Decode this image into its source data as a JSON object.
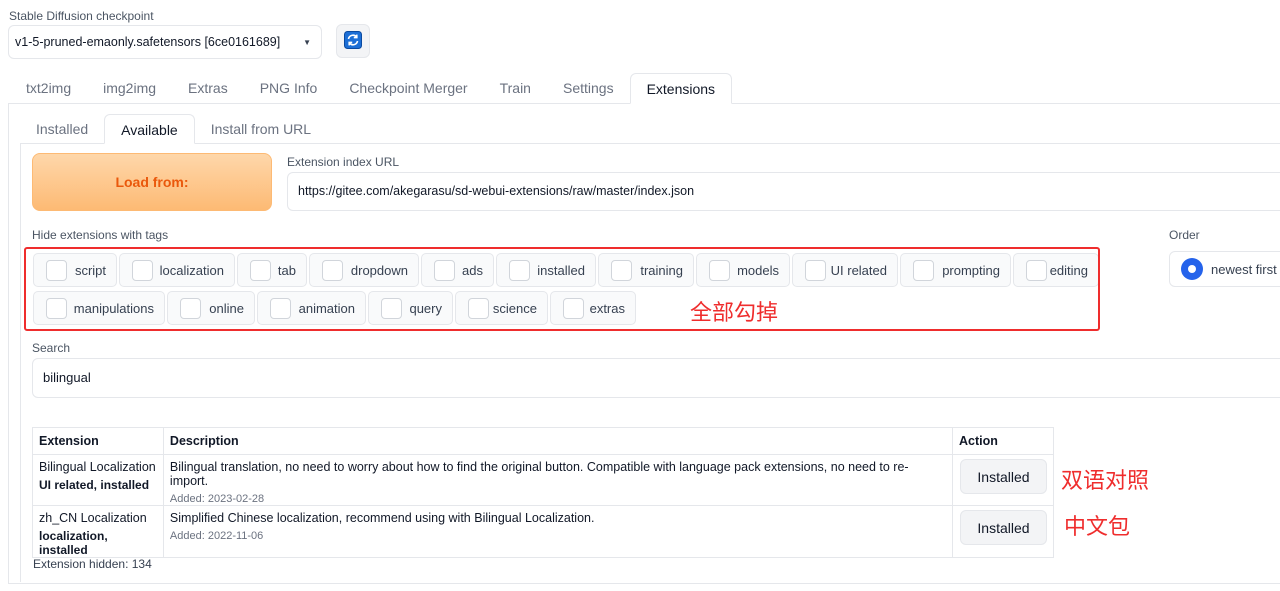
{
  "checkpoint": {
    "label": "Stable Diffusion checkpoint",
    "value": "v1-5-pruned-emaonly.safetensors [6ce0161689]"
  },
  "top_tabs": [
    "txt2img",
    "img2img",
    "Extras",
    "PNG Info",
    "Checkpoint Merger",
    "Train",
    "Settings",
    "Extensions"
  ],
  "active_top_tab": "Extensions",
  "sub_tabs": [
    "Installed",
    "Available",
    "Install from URL"
  ],
  "active_sub_tab": "Available",
  "available": {
    "load_button": "Load from:",
    "index_url_label": "Extension index URL",
    "index_url_value": "https://gitee.com/akegarasu/sd-webui-extensions/raw/master/index.json",
    "hide_tags_label": "Hide extensions with tags",
    "tags": [
      "script",
      "localization",
      "tab",
      "dropdown",
      "ads",
      "installed",
      "training",
      "models",
      "UI related",
      "prompting",
      "editing",
      "manipulations",
      "online",
      "animation",
      "query",
      "science",
      "extras"
    ],
    "order_label": "Order",
    "order_value": "newest first",
    "search_label": "Search",
    "search_value": "bilingual",
    "table": {
      "headers": [
        "Extension",
        "Description",
        "Action"
      ],
      "rows": [
        {
          "name": "Bilingual Localization",
          "tags": "UI related, installed",
          "description": "Bilingual translation, no need to worry about how to find the original button. Compatible with language pack extensions, no need to re-import.",
          "added": "Added: 2023-02-28",
          "action": "Installed"
        },
        {
          "name": "zh_CN Localization",
          "tags": "localization, installed",
          "description": "Simplified Chinese localization, recommend using with Bilingual Localization.",
          "added": "Added: 2022-11-06",
          "action": "Installed"
        }
      ]
    },
    "hidden_count": "Extension hidden: 134"
  },
  "annotations": {
    "uncheck_all": "全部勾掉",
    "bilingual": "双语对照",
    "chinese_pack": "中文包",
    "color": "#ef2d2d"
  },
  "icons": {
    "refresh": "refresh-icon",
    "dropdown": "chevron-down-icon"
  },
  "colors": {
    "load_button": "#fdba74",
    "radio_accent": "#2563eb"
  }
}
